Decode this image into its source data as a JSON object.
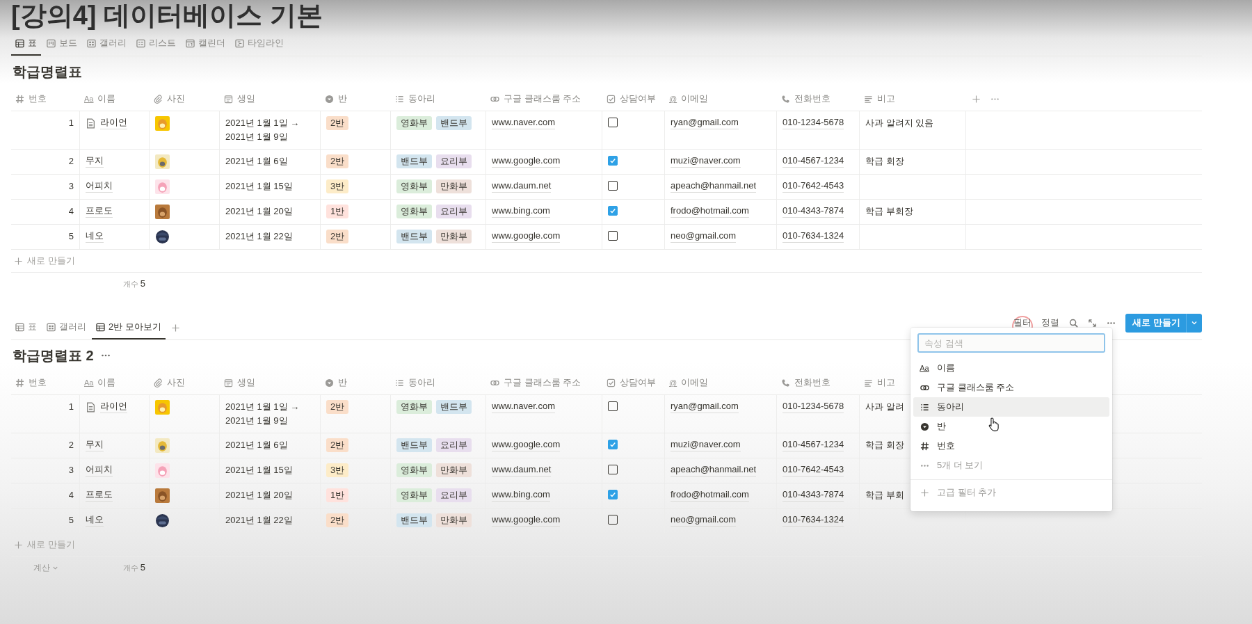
{
  "page_title": "[강의4] 데이터베이스 기본",
  "tables": [
    {
      "views": [
        {
          "label": "표",
          "kind": "table",
          "selected": true
        },
        {
          "label": "보드",
          "kind": "board",
          "selected": false
        },
        {
          "label": "갤러리",
          "kind": "gallery",
          "selected": false
        },
        {
          "label": "리스트",
          "kind": "list",
          "selected": false
        },
        {
          "label": "캘린더",
          "kind": "calendar",
          "selected": false
        },
        {
          "label": "타임라인",
          "kind": "timeline",
          "selected": false
        }
      ],
      "title": "학급명렬표",
      "columns": [
        {
          "label": "번호",
          "kind": "number"
        },
        {
          "label": "이름",
          "kind": "title",
          "glyph": "Aa"
        },
        {
          "label": "사진",
          "kind": "file"
        },
        {
          "label": "생일",
          "kind": "date"
        },
        {
          "label": "반",
          "kind": "select"
        },
        {
          "label": "동아리",
          "kind": "multi"
        },
        {
          "label": "구글 클래스룸 주소",
          "kind": "url"
        },
        {
          "label": "상담여부",
          "kind": "checkbox"
        },
        {
          "label": "이메일",
          "kind": "email",
          "glyph": "@"
        },
        {
          "label": "전화번호",
          "kind": "phone"
        },
        {
          "label": "비고",
          "kind": "text"
        }
      ],
      "rows": [
        {
          "number": "1",
          "name": "라이언",
          "page_icon": true,
          "photo": {
            "kind": "picture"
          },
          "birthday": [
            "2021년 1월 1일 →",
            "2021년 1월 9일"
          ],
          "class": {
            "label": "2반",
            "color": "#fadec9"
          },
          "clubs": [
            {
              "label": "영화부",
              "color": "#dbeddb"
            },
            {
              "label": "밴드부",
              "color": "#d3e5ef"
            }
          ],
          "url": "www.naver.com",
          "consult": false,
          "email": "ryan@gmail.com",
          "phone": "010-1234-5678",
          "note": "사과 알려지 있음"
        },
        {
          "number": "2",
          "name": "무지",
          "photo": {
            "kind": "picture"
          },
          "birthday": [
            "2021년 1월 6일"
          ],
          "class": {
            "label": "2반",
            "color": "#fadec9"
          },
          "clubs": [
            {
              "label": "밴드부",
              "color": "#d3e5ef"
            },
            {
              "label": "요리부",
              "color": "#e8deee"
            }
          ],
          "url": "www.google.com",
          "consult": true,
          "email": "muzi@naver.com",
          "phone": "010-4567-1234",
          "note": "학급 회장"
        },
        {
          "number": "3",
          "name": "어피치",
          "photo": {
            "kind": "picture"
          },
          "birthday": [
            "2021년 1월 15일"
          ],
          "class": {
            "label": "3반",
            "color": "#fdecc8"
          },
          "clubs": [
            {
              "label": "영화부",
              "color": "#dbeddb"
            },
            {
              "label": "만화부",
              "color": "#eee0da"
            }
          ],
          "url": "www.daum.net",
          "consult": false,
          "email": "apeach@hanmail.net",
          "phone": "010-7642-4543"
        },
        {
          "number": "4",
          "name": "프로도",
          "photo": {
            "kind": "picture"
          },
          "birthday": [
            "2021년 1월 20일"
          ],
          "class": {
            "label": "1반",
            "color": "#ffe2dd"
          },
          "clubs": [
            {
              "label": "영화부",
              "color": "#dbeddb"
            },
            {
              "label": "요리부",
              "color": "#e8deee"
            }
          ],
          "url": "www.bing.com",
          "consult": true,
          "email": "frodo@hotmail.com",
          "phone": "010-4343-7874",
          "note": "학급 부회장"
        },
        {
          "number": "5",
          "name": "네오",
          "photo": {
            "kind": "picture"
          },
          "birthday": [
            "2021년 1월 22일"
          ],
          "class": {
            "label": "2반",
            "color": "#fadec9"
          },
          "clubs": [
            {
              "label": "밴드부",
              "color": "#d3e5ef"
            },
            {
              "label": "만화부",
              "color": "#eee0da"
            }
          ],
          "url": "www.google.com",
          "consult": false,
          "email": "neo@gmail.com",
          "phone": "010-7634-1324"
        }
      ],
      "new_row": "새로 만들기",
      "count_label": "개수",
      "count": "5"
    },
    {
      "views": [
        {
          "label": "표",
          "kind": "table",
          "selected": false
        },
        {
          "label": "갤러리",
          "kind": "gallery",
          "selected": false
        },
        {
          "label": "2반 모아보기",
          "kind": "table",
          "selected": true
        }
      ],
      "add_view": true,
      "toolbar": {
        "filter": "필터",
        "sort": "정렬",
        "new_button": "새로 만들기"
      },
      "title": "학급명렬표 2",
      "title_menu": true,
      "columns": [
        {
          "label": "번호",
          "kind": "number"
        },
        {
          "label": "이름",
          "kind": "title",
          "glyph": "Aa"
        },
        {
          "label": "사진",
          "kind": "file"
        },
        {
          "label": "생일",
          "kind": "date"
        },
        {
          "label": "반",
          "kind": "select"
        },
        {
          "label": "동아리",
          "kind": "multi"
        },
        {
          "label": "구글 클래스룸 주소",
          "kind": "url"
        },
        {
          "label": "상담여부",
          "kind": "checkbox"
        },
        {
          "label": "이메일",
          "kind": "email",
          "glyph": "@"
        },
        {
          "label": "전화번호",
          "kind": "phone"
        },
        {
          "label": "비고",
          "kind": "text"
        }
      ],
      "rows": [
        {
          "number": "1",
          "name": "라이언",
          "page_icon": true,
          "photo": {
            "kind": "picture"
          },
          "birthday": [
            "2021년 1월 1일 →",
            "2021년 1월 9일"
          ],
          "class": {
            "label": "2반",
            "color": "#fadec9"
          },
          "clubs": [
            {
              "label": "영화부",
              "color": "#dbeddb"
            },
            {
              "label": "밴드부",
              "color": "#d3e5ef"
            }
          ],
          "url": "www.naver.com",
          "consult": false,
          "email": "ryan@gmail.com",
          "phone": "010-1234-5678",
          "note": "사과 알려"
        },
        {
          "number": "2",
          "name": "무지",
          "photo": {
            "kind": "picture"
          },
          "birthday": [
            "2021년 1월 6일"
          ],
          "class": {
            "label": "2반",
            "color": "#fadec9"
          },
          "clubs": [
            {
              "label": "밴드부",
              "color": "#d3e5ef"
            },
            {
              "label": "요리부",
              "color": "#e8deee"
            }
          ],
          "url": "www.google.com",
          "consult": true,
          "email": "muzi@naver.com",
          "phone": "010-4567-1234",
          "note": "학급 회장"
        },
        {
          "number": "3",
          "name": "어피치",
          "photo": {
            "kind": "picture"
          },
          "birthday": [
            "2021년 1월 15일"
          ],
          "class": {
            "label": "3반",
            "color": "#fdecc8"
          },
          "clubs": [
            {
              "label": "영화부",
              "color": "#dbeddb"
            },
            {
              "label": "만화부",
              "color": "#eee0da"
            }
          ],
          "url": "www.daum.net",
          "consult": false,
          "email": "apeach@hanmail.net",
          "phone": "010-7642-4543"
        },
        {
          "number": "4",
          "name": "프로도",
          "photo": {
            "kind": "picture"
          },
          "birthday": [
            "2021년 1월 20일"
          ],
          "class": {
            "label": "1반",
            "color": "#ffe2dd"
          },
          "clubs": [
            {
              "label": "영화부",
              "color": "#dbeddb"
            },
            {
              "label": "요리부",
              "color": "#e8deee"
            }
          ],
          "url": "www.bing.com",
          "consult": true,
          "email": "frodo@hotmail.com",
          "phone": "010-4343-7874",
          "note": "학급 부회"
        },
        {
          "number": "5",
          "name": "네오",
          "photo": {
            "kind": "picture"
          },
          "birthday": [
            "2021년 1월 22일"
          ],
          "class": {
            "label": "2반",
            "color": "#fadec9"
          },
          "clubs": [
            {
              "label": "밴드부",
              "color": "#d3e5ef"
            },
            {
              "label": "만화부",
              "color": "#eee0da"
            }
          ],
          "url": "www.google.com",
          "consult": false,
          "email": "neo@gmail.com",
          "phone": "010-7634-1324"
        }
      ],
      "new_row": "새로 만들기",
      "calc": "계산",
      "count_label": "개수",
      "count": "5"
    }
  ],
  "filter_menu": {
    "placeholder": "속성 검색",
    "items": [
      {
        "label": "이름",
        "kind": "title",
        "glyph": "Aa",
        "selected": false
      },
      {
        "label": "구글 클래스룸 주소",
        "kind": "url",
        "selected": false
      },
      {
        "label": "동아리",
        "kind": "multi",
        "selected": true
      },
      {
        "label": "반",
        "kind": "select",
        "selected": false
      },
      {
        "label": "번호",
        "kind": "number",
        "selected": false
      }
    ],
    "more": "5개 더 보기",
    "advanced": "고급 필터 추가"
  }
}
